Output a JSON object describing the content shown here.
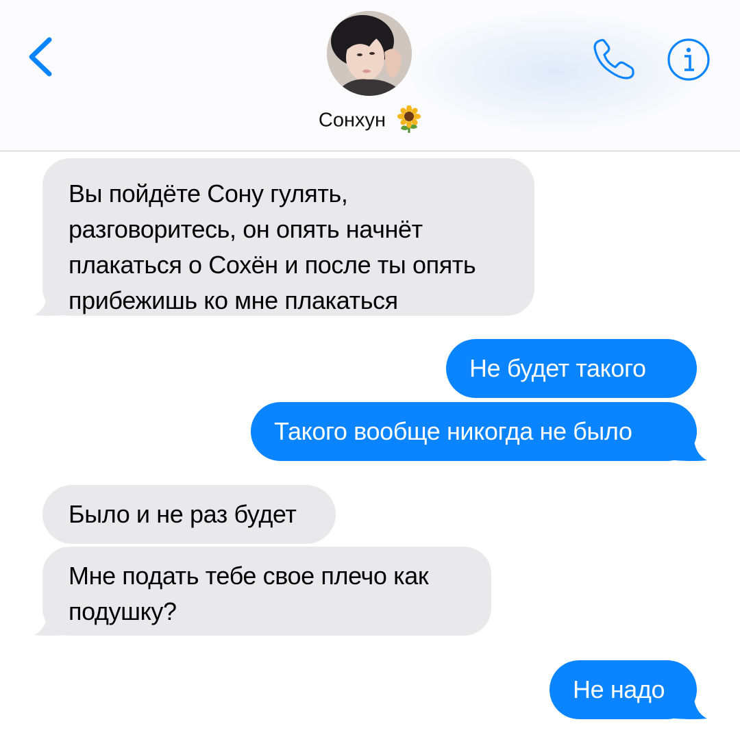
{
  "header": {
    "back_icon": "chevron-left-icon",
    "contact_name": "Сонхун",
    "contact_emoji": "sunflower",
    "call_icon": "phone-icon",
    "info_icon": "info-icon",
    "accent_color": "#0a84ff"
  },
  "messages": [
    {
      "direction": "incoming",
      "text": "Вы пойдёте Сону гулять,\nразговоритесь, он опять начнёт\nплакаться о Сохён и после ты опять\nприбежишь ко мне плакаться"
    },
    {
      "direction": "outgoing",
      "text": "Не будет такого"
    },
    {
      "direction": "outgoing",
      "text": "Такого вообще никогда не было"
    },
    {
      "direction": "incoming",
      "text": "Было и не раз будет"
    },
    {
      "direction": "incoming",
      "text": "Мне подать тебе свое плечо как\nподушку?"
    },
    {
      "direction": "outgoing",
      "text": "Не надо"
    }
  ],
  "colors": {
    "incoming_bubble": "#e9e9eb",
    "outgoing_bubble": "#0a84ff"
  }
}
